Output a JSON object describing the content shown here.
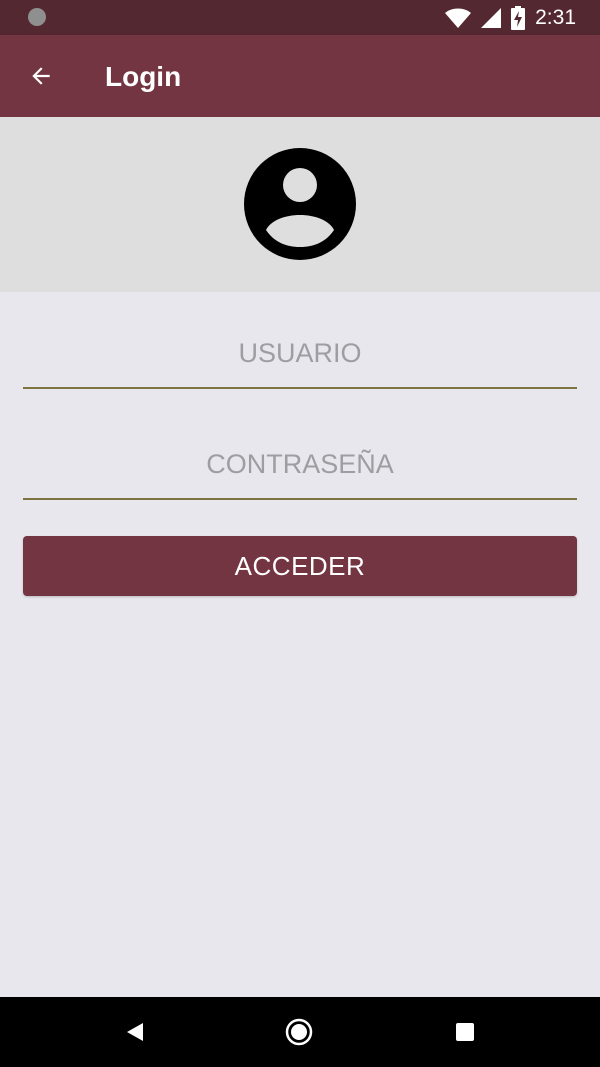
{
  "status_bar": {
    "time": "2:31",
    "icons": [
      "notification-dot-icon",
      "wifi-icon",
      "signal-icon",
      "battery-charging-icon"
    ]
  },
  "app_bar": {
    "back_icon": "arrow-back-icon",
    "title": "Login"
  },
  "avatar": {
    "icon": "account-circle-icon"
  },
  "form": {
    "username": {
      "value": "",
      "placeholder": "USUARIO"
    },
    "password": {
      "value": "",
      "placeholder": "CONTRASEÑA"
    },
    "submit_label": "ACCEDER"
  },
  "nav_bar": {
    "icons": [
      "nav-back-icon",
      "nav-home-icon",
      "nav-recents-icon"
    ]
  },
  "colors": {
    "status_bar": "#542831",
    "primary": "#743542",
    "avatar_band": "#dedede",
    "background": "#e8e7ed",
    "field_underline": "#7f7440"
  }
}
